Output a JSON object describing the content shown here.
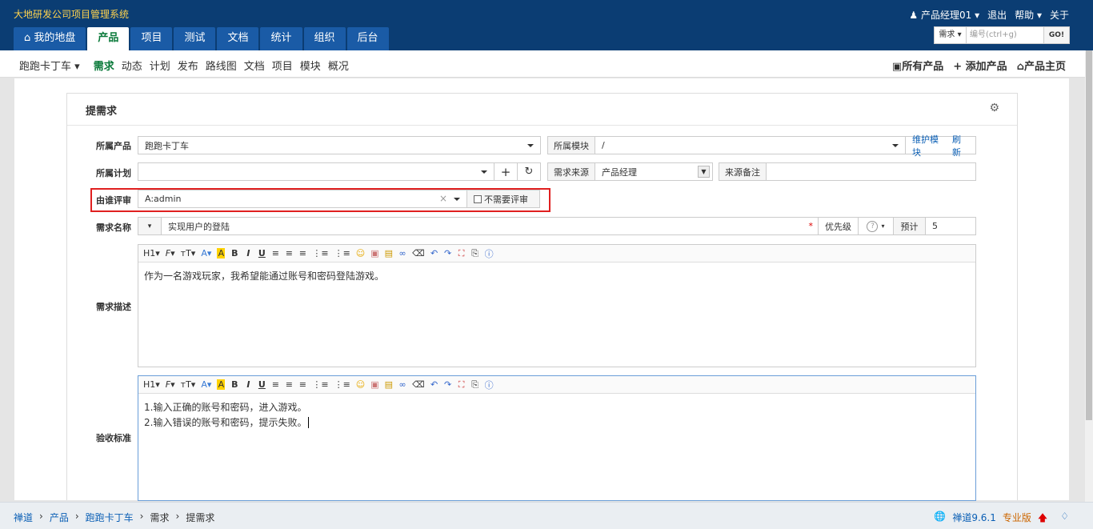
{
  "header": {
    "brand": "大地研发公司项目管理系统",
    "user": "产品经理01",
    "logout": "退出",
    "help": "帮助",
    "about": "关于",
    "tabs": [
      {
        "label": "我的地盘",
        "active": false
      },
      {
        "label": "产品",
        "active": true
      },
      {
        "label": "项目",
        "active": false
      },
      {
        "label": "测试",
        "active": false
      },
      {
        "label": "文档",
        "active": false
      },
      {
        "label": "统计",
        "active": false
      },
      {
        "label": "组织",
        "active": false
      },
      {
        "label": "后台",
        "active": false
      }
    ],
    "search": {
      "type": "需求",
      "placeholder": "编号(ctrl+g)",
      "go": "GO!"
    }
  },
  "subnav": {
    "product": "跑跑卡丁车",
    "items": [
      "需求",
      "动态",
      "计划",
      "发布",
      "路线图",
      "文档",
      "项目",
      "模块",
      "概况"
    ],
    "active": "需求",
    "right": [
      "所有产品",
      "添加产品",
      "产品主页"
    ]
  },
  "form": {
    "title": "提需求",
    "product_label": "所属产品",
    "product_value": "跑跑卡丁车",
    "module_label": "所属模块",
    "module_value": "/",
    "maintain_module": "维护模块",
    "refresh": "刷新",
    "plan_label": "所属计划",
    "plan_value": "",
    "source_label": "需求来源",
    "source_value": "产品经理",
    "source_note_label": "来源备注",
    "source_note_value": "",
    "reviewer_label": "由谁评审",
    "reviewer_value": "A:admin",
    "no_review_label": "不需要评审",
    "name_label": "需求名称",
    "name_value": "实现用户的登陆",
    "priority_label": "优先级",
    "estimate_label": "预计",
    "estimate_value": "5",
    "desc_label": "需求描述",
    "desc_text": "作为一名游戏玩家，我希望能通过账号和密码登陆游戏。",
    "verify_label": "验收标准",
    "verify_line1": "1.输入正确的账号和密码，进入游戏。",
    "verify_line2": "2.输入错误的账号和密码，提示失败。"
  },
  "footer": {
    "crumbs": [
      "禅道",
      "产品",
      "跑跑卡丁车",
      "需求",
      "提需求"
    ],
    "version": "禅道9.6.1",
    "edition": "专业版"
  }
}
